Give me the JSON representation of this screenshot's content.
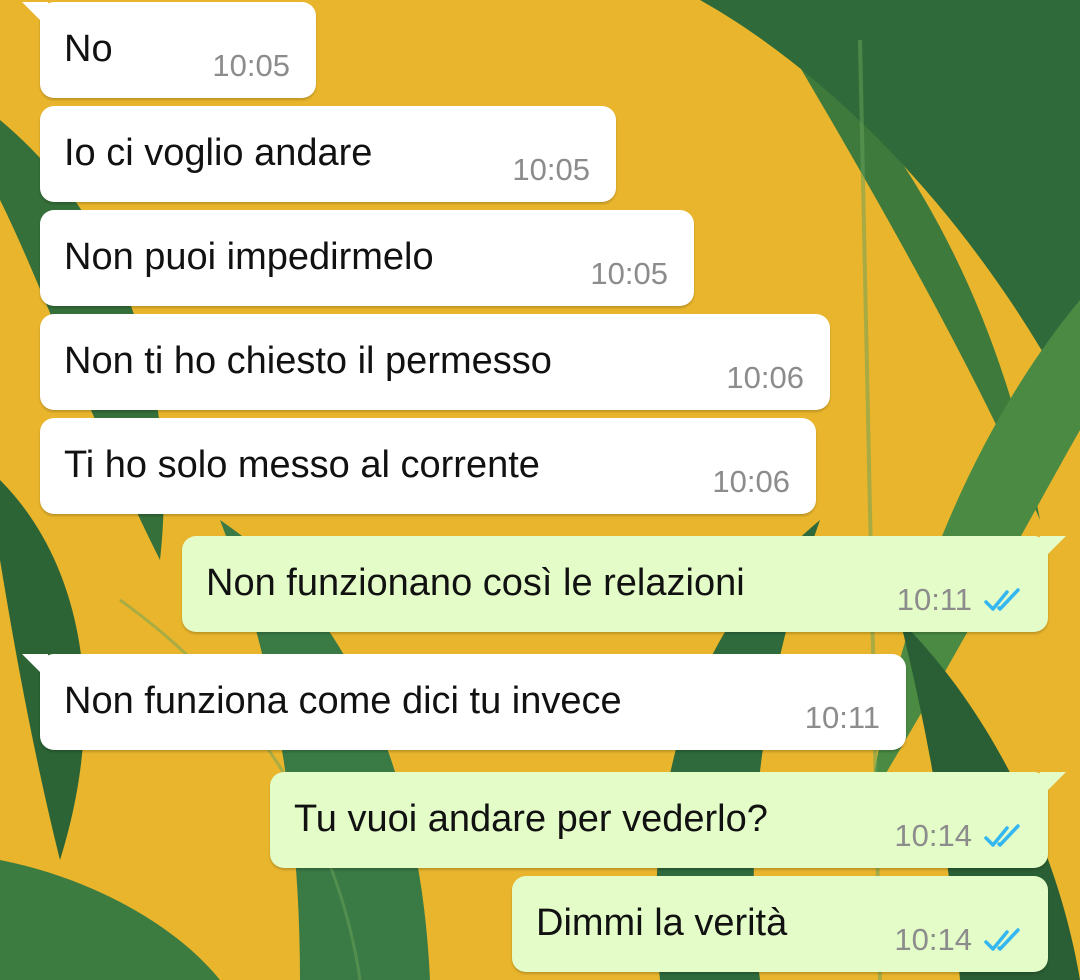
{
  "colors": {
    "incoming_bubble": "#ffffff",
    "outgoing_bubble": "#e3fcc8",
    "timestamp": "#8c8c8c",
    "read_ticks": "#34b7f1",
    "wallpaper_yellow": "#e8b52c",
    "leaf_green": "#2f6b3a"
  },
  "messages": [
    {
      "direction": "incoming",
      "text": "No",
      "time": "10:05"
    },
    {
      "direction": "incoming",
      "text": "Io ci voglio andare",
      "time": "10:05"
    },
    {
      "direction": "incoming",
      "text": "Non puoi impedirmelo",
      "time": "10:05"
    },
    {
      "direction": "incoming",
      "text": "Non ti ho chiesto il permesso",
      "time": "10:06"
    },
    {
      "direction": "incoming",
      "text": "Ti ho solo messo al corrente",
      "time": "10:06"
    },
    {
      "direction": "outgoing",
      "text": "Non funzionano così le relazioni",
      "time": "10:11",
      "status_icon": "double-check-read-icon"
    },
    {
      "direction": "incoming",
      "text": "Non funziona come dici tu invece",
      "time": "10:11"
    },
    {
      "direction": "outgoing",
      "text": "Tu vuoi andare per vederlo?",
      "time": "10:14",
      "status_icon": "double-check-read-icon"
    },
    {
      "direction": "outgoing",
      "text": "Dimmi la verità",
      "time": "10:14",
      "status_icon": "double-check-read-icon"
    }
  ]
}
